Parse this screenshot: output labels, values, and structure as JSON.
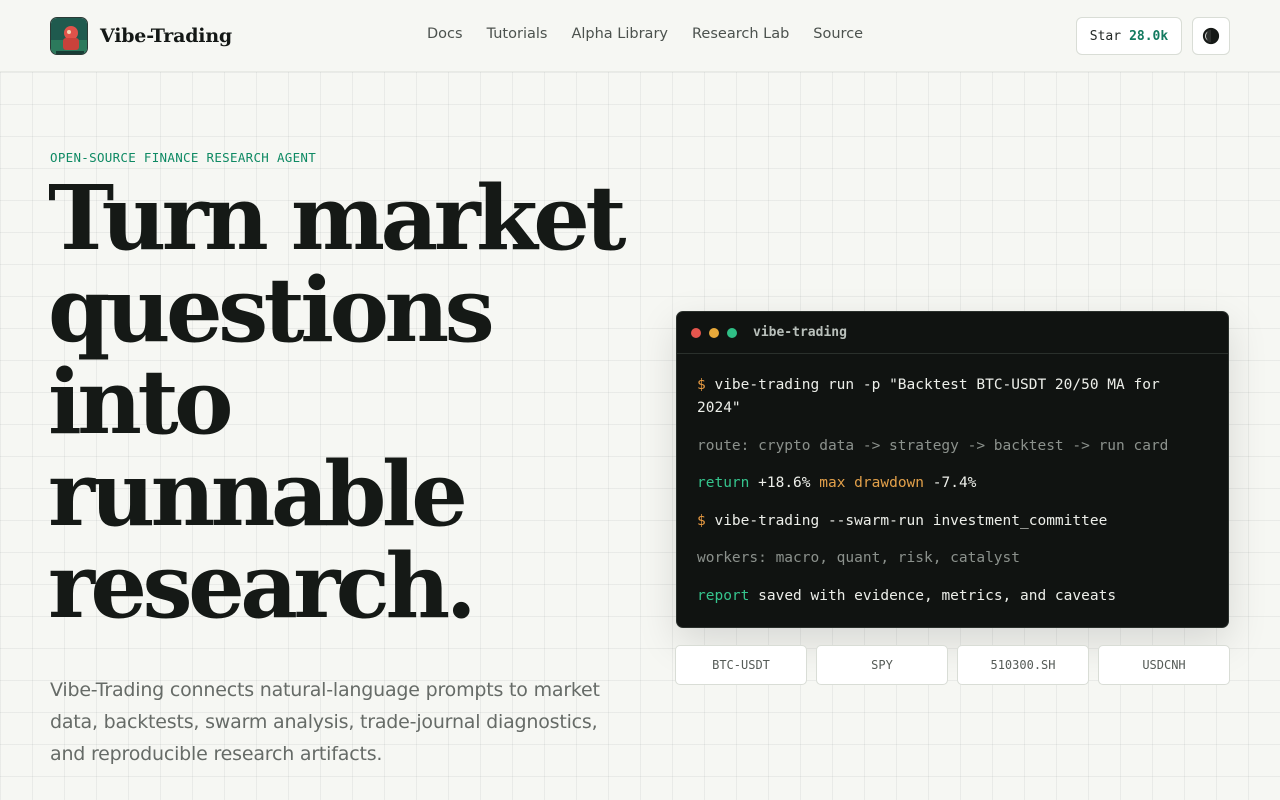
{
  "header": {
    "brand": "Vibe-Trading",
    "nav": [
      {
        "label": "Docs"
      },
      {
        "label": "Tutorials"
      },
      {
        "label": "Alpha Library"
      },
      {
        "label": "Research Lab"
      },
      {
        "label": "Source"
      }
    ],
    "star_label": "Star",
    "star_count": "28.0k",
    "theme_icon": "theme-toggle-icon"
  },
  "hero": {
    "eyebrow": "OPEN-SOURCE FINANCE RESEARCH AGENT",
    "headline": "Turn market questions into runnable research.",
    "subtext": "Vibe-Trading connects natural-language prompts to market data, backtests, swarm analysis, trade-journal diagnostics, and reproducible research artifacts."
  },
  "terminal": {
    "title": "vibe-trading",
    "lines": {
      "l1_prompt": "$",
      "l1_cmd": "vibe-trading run -p \"Backtest BTC-USDT 20/50 MA for 2024\"",
      "l2": "route: crypto data -> strategy -> backtest -> run card",
      "l3_k1": "return",
      "l3_v1": "+18.6%",
      "l3_k2": "max drawdown",
      "l3_v2": "-7.4%",
      "l4_prompt": "$",
      "l4_cmd": "vibe-trading --swarm-run investment_committee",
      "l5": "workers: macro, quant, risk, catalyst",
      "l6_k": "report",
      "l6_v": "saved with evidence, metrics, and caveats"
    }
  },
  "chips": [
    {
      "label": "BTC-USDT"
    },
    {
      "label": "SPY"
    },
    {
      "label": "510300.SH"
    },
    {
      "label": "USDCNH"
    }
  ],
  "colors": {
    "accent_green": "#0f8a64",
    "prompt_orange": "#e79a42",
    "terminal_bg": "#101311",
    "page_bg": "#f6f7f3"
  }
}
